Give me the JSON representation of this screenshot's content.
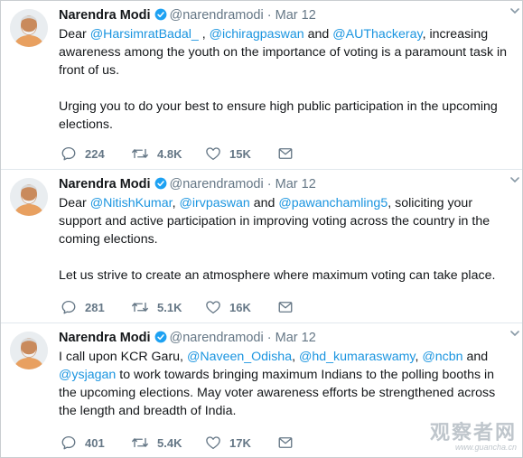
{
  "colors": {
    "mention": "#1b95e0",
    "meta": "#657786",
    "verified_badge": "#1da1f2",
    "divider": "#e1e8ed"
  },
  "tweets": [
    {
      "name": "Narendra Modi",
      "handle": "@narendramodi",
      "separator": "·",
      "date": "Mar 12",
      "paragraphs": [
        [
          {
            "t": "Dear "
          },
          {
            "t": "@HarsimratBadal_",
            "m": true
          },
          {
            "t": " , "
          },
          {
            "t": "@ichiragpaswan",
            "m": true
          },
          {
            "t": " and "
          },
          {
            "t": "@AUThackeray",
            "m": true
          },
          {
            "t": ", increasing awareness among the youth on the importance of voting is a paramount task in front of us."
          }
        ],
        [
          {
            "t": "Urging you to do your best to ensure high public participation in the upcoming elections."
          }
        ]
      ],
      "replies": "224",
      "retweets": "4.8K",
      "likes": "15K"
    },
    {
      "name": "Narendra Modi",
      "handle": "@narendramodi",
      "separator": "·",
      "date": "Mar 12",
      "paragraphs": [
        [
          {
            "t": "Dear "
          },
          {
            "t": "@NitishKumar",
            "m": true
          },
          {
            "t": ", "
          },
          {
            "t": "@irvpaswan",
            "m": true
          },
          {
            "t": " and "
          },
          {
            "t": "@pawanchamling5",
            "m": true
          },
          {
            "t": ", soliciting your support and active participation in improving voting across the country in the coming elections."
          }
        ],
        [
          {
            "t": "Let us strive to create an atmosphere where maximum voting can take place."
          }
        ]
      ],
      "replies": "281",
      "retweets": "5.1K",
      "likes": "16K"
    },
    {
      "name": "Narendra Modi",
      "handle": "@narendramodi",
      "separator": "·",
      "date": "Mar 12",
      "paragraphs": [
        [
          {
            "t": "I call upon KCR Garu, "
          },
          {
            "t": "@Naveen_Odisha",
            "m": true
          },
          {
            "t": ", "
          },
          {
            "t": "@hd_kumaraswamy",
            "m": true
          },
          {
            "t": ", "
          },
          {
            "t": "@ncbn",
            "m": true
          },
          {
            "t": " and "
          },
          {
            "t": "@ysjagan",
            "m": true
          },
          {
            "t": " to work towards bringing maximum Indians to the polling booths in the upcoming elections. May voter awareness efforts be strengthened across the length and breadth of India."
          }
        ]
      ],
      "replies": "401",
      "retweets": "5.4K",
      "likes": "17K"
    }
  ],
  "watermark": {
    "main": "观察者网",
    "sub": "www.guancha.cn"
  }
}
